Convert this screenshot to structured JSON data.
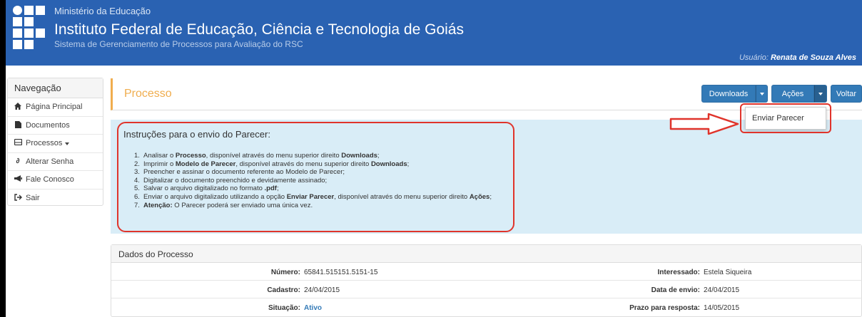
{
  "header": {
    "ministry": "Ministério da Educação",
    "institute": "Instituto Federal de Educação, Ciência e Tecnologia de Goiás",
    "system": "Sistema de Gerenciamento de Processos para Avaliação do RSC",
    "user_label": "Usuário:",
    "user_name": "Renata de Souza Alves"
  },
  "sidebar": {
    "title": "Navegação",
    "items": [
      {
        "label": "Página Principal",
        "icon": "home-icon"
      },
      {
        "label": "Documentos",
        "icon": "file-icon"
      },
      {
        "label": "Processos",
        "icon": "folder-icon"
      },
      {
        "label": "Alterar Senha",
        "icon": "link-icon"
      },
      {
        "label": "Fale Conosco",
        "icon": "bullhorn-icon"
      },
      {
        "label": "Sair",
        "icon": "logout-icon"
      }
    ]
  },
  "page": {
    "title": "Processo",
    "downloads_label": "Downloads",
    "acoes_label": "Ações",
    "voltar_label": "Voltar"
  },
  "dropdown": {
    "item": "Enviar Parecer"
  },
  "instructions": {
    "title": "Instruções para o envio do Parecer:",
    "steps": [
      {
        "n": "1.",
        "a": "Analisar o ",
        "b": "Processo",
        "c": ", disponível através do menu superior direito ",
        "d": "Downloads",
        "e": ";"
      },
      {
        "n": "2.",
        "a": "Imprimir o ",
        "b": "Modelo de Parecer",
        "c": ", disponível através do menu superior direito ",
        "d": "Downloads",
        "e": ";"
      },
      {
        "n": "3.",
        "a": "Preencher e assinar o documento referente ao Modelo de Parecer;",
        "b": "",
        "c": "",
        "d": "",
        "e": ""
      },
      {
        "n": "4.",
        "a": "Digitalizar o documento preenchido e devidamente assinado;",
        "b": "",
        "c": "",
        "d": "",
        "e": ""
      },
      {
        "n": "5.",
        "a": "Salvar o arquivo digitalizado no formato ",
        "b": ".pdf",
        "c": ";",
        "d": "",
        "e": ""
      },
      {
        "n": "6.",
        "a": "Enviar o arquivo digitalizado utilizando a opção ",
        "b": "Enviar Parecer",
        "c": ", disponível através do menu superior direito ",
        "d": "Ações",
        "e": ";"
      },
      {
        "n": "7.",
        "a": "",
        "b": "Atenção:",
        "c": " O Parecer poderá ser enviado uma única vez.",
        "d": "",
        "e": ""
      }
    ]
  },
  "dados": {
    "title": "Dados do Processo",
    "numero_label": "Número:",
    "numero": "65841.515151.5151-15",
    "interessado_label": "Interessado:",
    "interessado": "Estela Siqueira",
    "cadastro_label": "Cadastro:",
    "cadastro": "24/04/2015",
    "envio_label": "Data de envio:",
    "envio": "24/04/2015",
    "situacao_label": "Situação:",
    "situacao": "Ativo",
    "prazo_label": "Prazo para resposta:",
    "prazo": "14/05/2015"
  },
  "colors": {
    "header_bg": "#2a62b2",
    "accent_orange": "#f0ad4e",
    "button_blue": "#337ab7",
    "info_bg": "#d9edf7",
    "highlight_red": "#e0342b"
  }
}
